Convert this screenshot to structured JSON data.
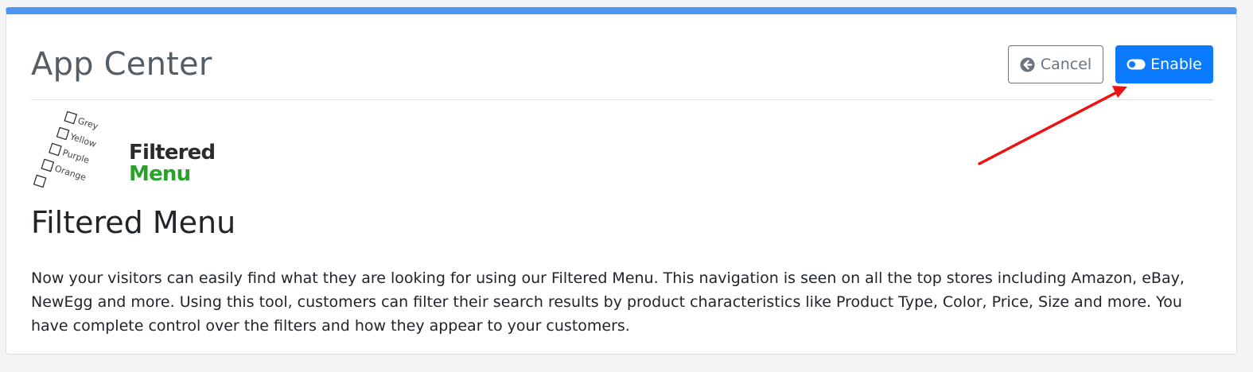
{
  "header": {
    "title": "App Center",
    "cancel_label": "Cancel",
    "enable_label": "Enable"
  },
  "logo": {
    "word1": "Filtered",
    "word2": "Menu",
    "checkbox_labels": [
      "Grey",
      "Yellow",
      "Purple",
      "Orange"
    ]
  },
  "app": {
    "title": "Filtered Menu",
    "description": "Now your visitors can easily find what they are looking for using our Filtered Menu. This navigation is seen on all the top stores including Amazon, eBay, NewEgg and more. Using this tool, customers can filter their search results by product characteristics like Product Type, Color, Price, Size and more. You have complete control over the filters and how they appear to your customers."
  },
  "colors": {
    "accent_bar": "#4a96f0",
    "primary": "#0a7bff",
    "secondary": "#6c757d",
    "logo_green": "#2aa12a",
    "annotation_arrow": "#ee1111"
  },
  "icons": {
    "cancel": "circle-arrow-left-icon",
    "enable": "toggle-on-icon"
  }
}
